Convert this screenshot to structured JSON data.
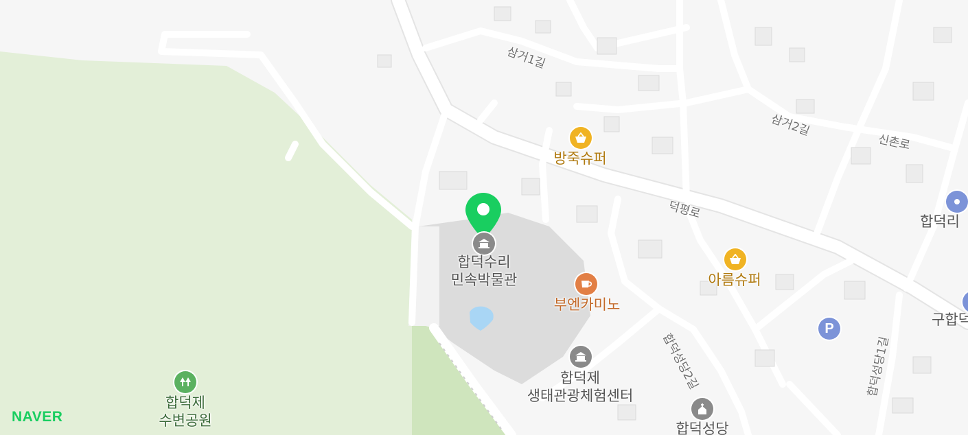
{
  "brand": {
    "logo_text": "NAVER",
    "color": "#19ce60"
  },
  "selected_place": {
    "name_line1": "합덕수리",
    "name_line2": "민속박물관",
    "marker_color": "#19ce60"
  },
  "pois": {
    "bangjuk_super": "방죽슈퍼",
    "areum_super": "아름슈퍼",
    "buencamino": "부엔카미노",
    "ecotour_line1": "합덕제",
    "ecotour_line2": "생태관광체험센터",
    "church": "합덕성당",
    "park_line1": "합덕제",
    "park_line2": "수변공원",
    "hapdeok_ri_partial": "합덕리",
    "gu_hapdeok_partial": "구합덕"
  },
  "roads": {
    "samgeo1": "삼거1길",
    "samgeo2": "삼거2길",
    "sinchon": "신촌로",
    "deokpyeong": "덕평로",
    "hapdeokseongdang2": "합덕성당2길",
    "hapdeokseongdang1": "합덕성당1길"
  },
  "icons": {
    "shop": "shopping-basket-icon",
    "cafe": "coffee-cup-icon",
    "landmark": "museum-icon",
    "church": "church-icon",
    "park": "tree-icon",
    "parking": "parking-icon",
    "parking_label": "P",
    "transit": "place-circle-icon"
  },
  "colors": {
    "shop": "#f0b323",
    "cafe": "#e27f45",
    "landmark": "#8a8a8a",
    "park": "#5bb160",
    "parking": "#7c93d8",
    "green_area": "#e3efd8",
    "water": "#a9d6f5"
  }
}
